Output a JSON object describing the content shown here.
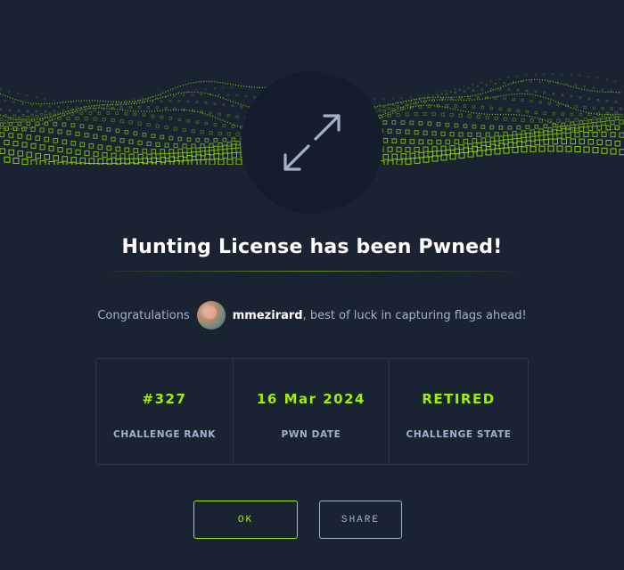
{
  "modal": {
    "title": "Hunting License has been Pwned!",
    "congrats_prefix": "Congratulations",
    "username": "mmezirard",
    "congrats_suffix": ", best of luck in capturing flags ahead!",
    "stats": [
      {
        "value": "#327",
        "label": "CHALLENGE RANK"
      },
      {
        "value": "16 Mar 2024",
        "label": "PWN DATE"
      },
      {
        "value": "RETIRED",
        "label": "CHALLENGE STATE"
      }
    ],
    "buttons": {
      "ok_label": "OK",
      "share_label": "SHARE"
    },
    "badge_icon": "expand-arrows-icon"
  },
  "colors": {
    "background": "#1a2332",
    "badge_background": "#141d2b",
    "accent": "#9fef00",
    "muted_text": "#a4b1cd",
    "heading_text": "#ffffff"
  }
}
